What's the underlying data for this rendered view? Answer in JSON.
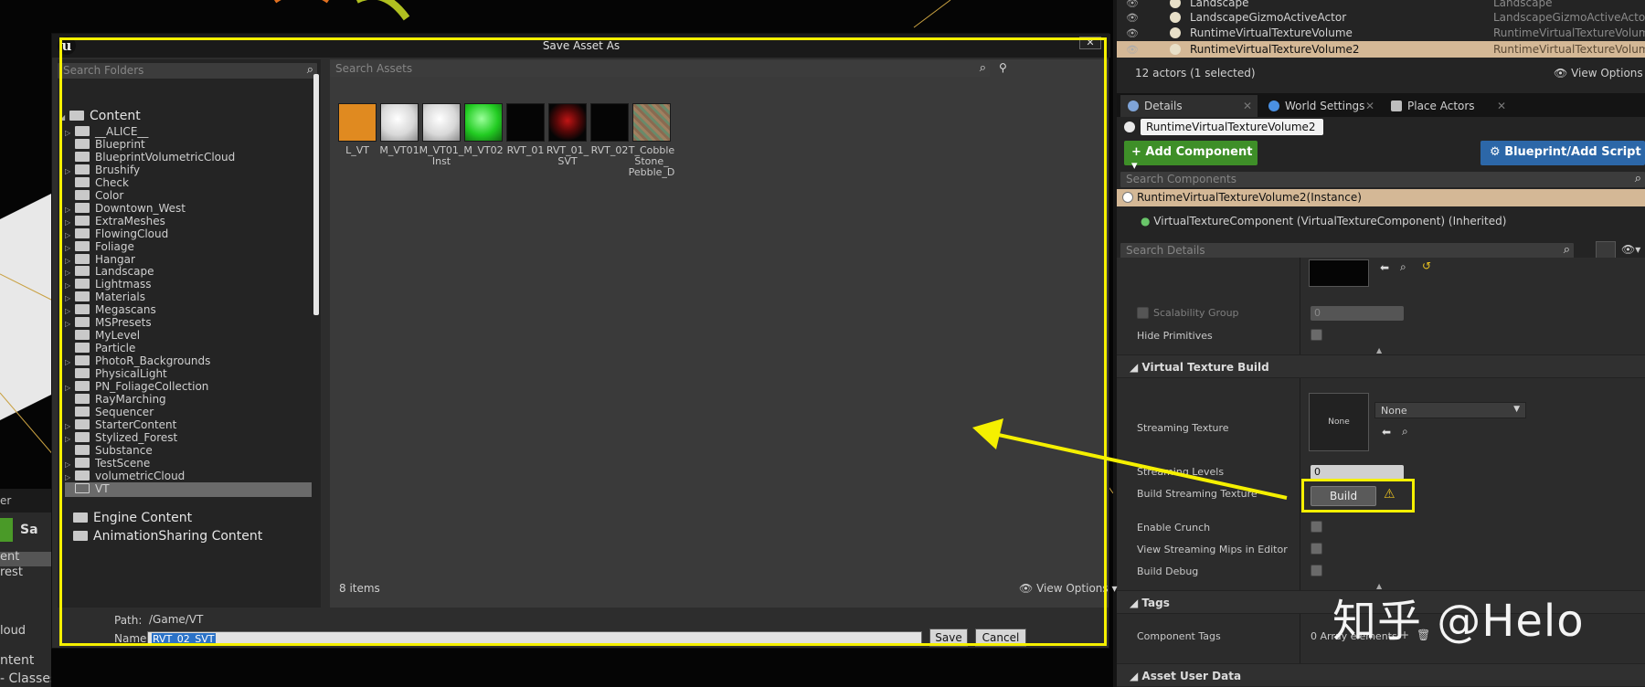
{
  "dialog": {
    "title": "Save Asset As",
    "folder_search_placeholder": "Search Folders",
    "asset_search_placeholder": "Search Assets",
    "folders": [
      {
        "label": "Content",
        "root": true
      },
      {
        "label": "__ALICE__"
      },
      {
        "label": "Blueprint"
      },
      {
        "label": "BlueprintVolumetricCloud"
      },
      {
        "label": "Brushify"
      },
      {
        "label": "Check"
      },
      {
        "label": "Color"
      },
      {
        "label": "Downtown_West"
      },
      {
        "label": "ExtraMeshes"
      },
      {
        "label": "FlowingCloud"
      },
      {
        "label": "Foliage"
      },
      {
        "label": "Hangar"
      },
      {
        "label": "Landscape"
      },
      {
        "label": "Lightmass"
      },
      {
        "label": "Materials"
      },
      {
        "label": "Megascans"
      },
      {
        "label": "MSPresets"
      },
      {
        "label": "MyLevel"
      },
      {
        "label": "Particle"
      },
      {
        "label": "PhotoR_Backgrounds"
      },
      {
        "label": "PhysicalLight"
      },
      {
        "label": "PN_FoliageCollection"
      },
      {
        "label": "RayMarching"
      },
      {
        "label": "Sequencer"
      },
      {
        "label": "StarterContent"
      },
      {
        "label": "Stylized_Forest"
      },
      {
        "label": "Substance"
      },
      {
        "label": "TestScene"
      },
      {
        "label": "volumetricCloud"
      },
      {
        "label": "VT"
      },
      {
        "label": "Engine Content",
        "root": true
      },
      {
        "label": "AnimationSharing Content",
        "root": true
      }
    ],
    "assets": [
      {
        "label": "L_VT"
      },
      {
        "label": "M_VT01"
      },
      {
        "label": "M_VT01_\nInst"
      },
      {
        "label": "M_VT02"
      },
      {
        "label": "RVT_01"
      },
      {
        "label": "RVT_01_\nSVT"
      },
      {
        "label": "RVT_02"
      },
      {
        "label": "T_Cobble\nStone_\nPebble_D"
      }
    ],
    "items_count": "8 items",
    "view_options": "View Options",
    "path_label": "Path:",
    "path_value": "/Game/VT",
    "name_label": "Name:",
    "name_value": "RVT_02_SVT",
    "save_label": "Save",
    "cancel_label": "Cancel",
    "close_label": "✕"
  },
  "outliner": {
    "rows": [
      {
        "name": "Landscape",
        "type": "Landscape"
      },
      {
        "name": "LandscapeGizmoActiveActor",
        "type": "LandscapeGizmoActiveActor"
      },
      {
        "name": "RuntimeVirtualTextureVolume",
        "type": "RuntimeVirtualTextureVolum"
      },
      {
        "name": "RuntimeVirtualTextureVolume2",
        "type": "RuntimeVirtualTextureVolum"
      }
    ],
    "actor_count": "12 actors (1 selected)",
    "view_options": "View Options"
  },
  "details": {
    "tabs": [
      "Details",
      "World Settings",
      "Place Actors"
    ],
    "actor_name": "RuntimeVirtualTextureVolume2",
    "add_component": "+ Add Component",
    "blueprint_script": "Blueprint/Add Script",
    "search_components_placeholder": "Search Components",
    "instance_label": "RuntimeVirtualTextureVolume2(Instance)",
    "inherited_label": "VirtualTextureComponent (VirtualTextureComponent) (Inherited)",
    "search_details_placeholder": "Search Details",
    "scalability_group": "Scalability Group",
    "scalability_value": "0",
    "hide_primitives": "Hide Primitives",
    "section_vt_build": "Virtual Texture Build",
    "streaming_texture": "Streaming Texture",
    "streaming_texture_thumb": "None",
    "streaming_texture_value": "None",
    "streaming_levels": "Streaming Levels",
    "streaming_levels_value": "0",
    "build_streaming_texture": "Build Streaming Texture",
    "build_label": "Build",
    "build_warning": "⚠",
    "enable_crunch": "Enable Crunch",
    "view_streaming_mips": "View Streaming Mips in Editor",
    "build_debug": "Build Debug",
    "section_tags": "Tags",
    "component_tags": "Component Tags",
    "component_tags_value": "0 Array elements",
    "section_asset_user_data": "Asset User Data"
  },
  "left_browser": {
    "tab_label": "er",
    "save_label": "Sa",
    "rows": [
      "ent",
      "rest",
      "loud",
      "ntent",
      "- Classes"
    ]
  },
  "watermark": "知乎 @Helo",
  "colors": {
    "highlight": "#f5f000",
    "selection": "#d4b896",
    "add_component": "#3e8f28",
    "blueprint": "#2c67a8"
  }
}
